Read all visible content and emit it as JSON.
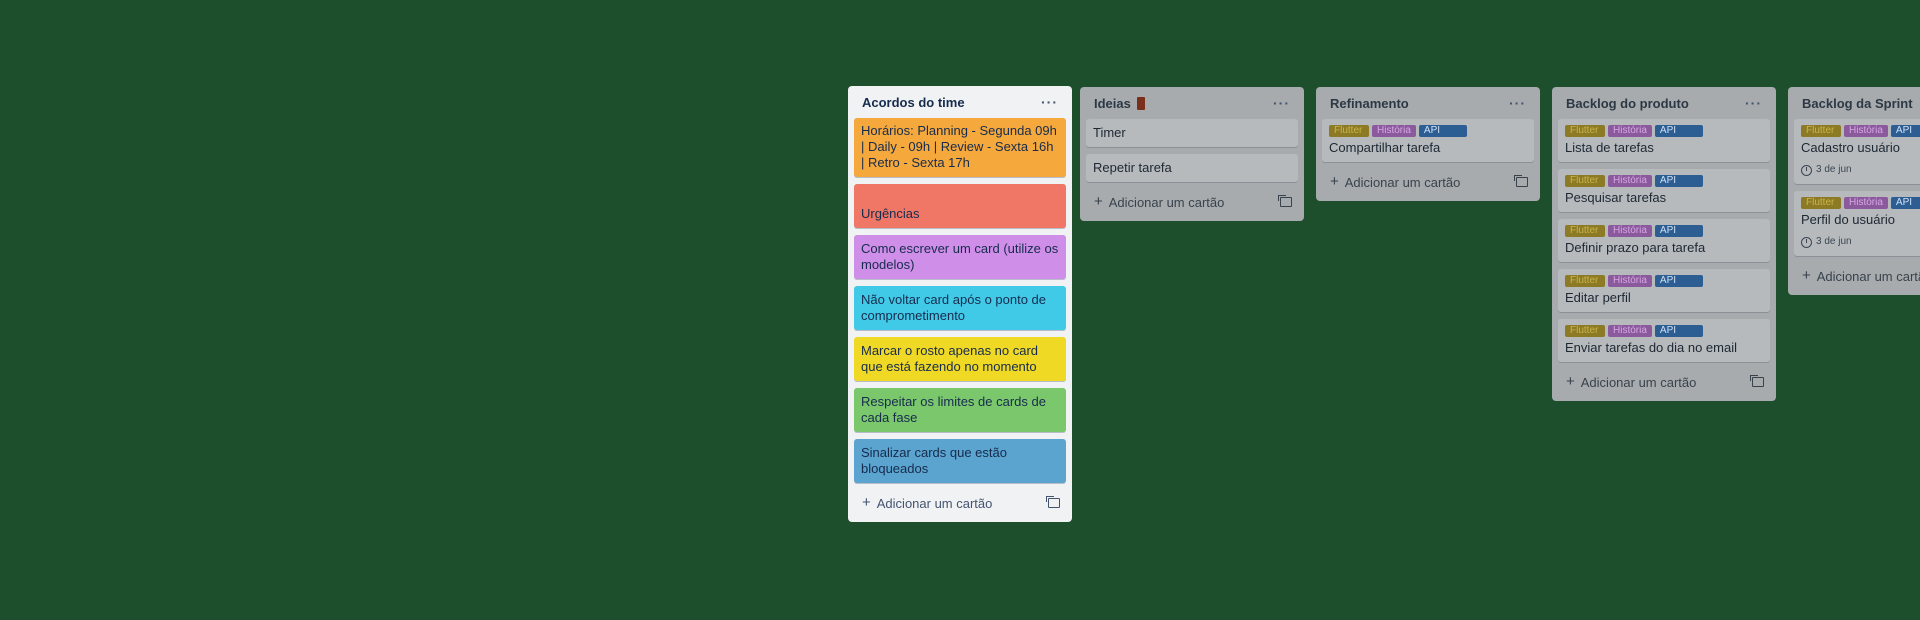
{
  "lists": [
    {
      "title": "Acordos do time",
      "cards": [
        {
          "text": "Horários: Planning - Segunda 09h | Daily - 09h | Review - Sexta 16h | Retro - Sexta 17h",
          "color": "#f5a93c"
        },
        {
          "text": "Urgências",
          "color": "#f07765"
        },
        {
          "text": "Como escrever um card (utilize os modelos)",
          "color": "#cf8ee8"
        },
        {
          "text": "Não voltar card após o ponto de comprometimento",
          "color": "#40cae8"
        },
        {
          "text": "Marcar o rosto apenas no card que está fazendo no momento",
          "color": "#f0d924"
        },
        {
          "text": "Respeitar os limites de cards de cada fase",
          "color": "#7bc86c"
        },
        {
          "text": "Sinalizar cards que estão bloqueados",
          "color": "#5ba4cf"
        }
      ],
      "add_label": "Adicionar um cartão"
    },
    {
      "title": "Ideias",
      "cards": [
        {
          "text": "Timer"
        },
        {
          "text": "Repetir tarefa"
        }
      ],
      "add_label": "Adicionar um cartão"
    },
    {
      "title": "Refinamento",
      "cards": [
        {
          "labels": [
            "Flutter",
            "História",
            "API"
          ],
          "text": "Compartilhar tarefa"
        }
      ],
      "add_label": "Adicionar um cartão"
    },
    {
      "title": "Backlog do produto",
      "cards": [
        {
          "labels": [
            "Flutter",
            "História",
            "API"
          ],
          "text": "Lista de tarefas"
        },
        {
          "labels": [
            "Flutter",
            "História",
            "API"
          ],
          "text": "Pesquisar tarefas"
        },
        {
          "labels": [
            "Flutter",
            "História",
            "API"
          ],
          "text": "Definir prazo para tarefa"
        },
        {
          "labels": [
            "Flutter",
            "História",
            "API"
          ],
          "text": "Editar perfil"
        },
        {
          "labels": [
            "Flutter",
            "História",
            "API"
          ],
          "text": "Enviar tarefas do dia no email"
        }
      ],
      "add_label": "Adicionar um cartão"
    },
    {
      "title": "Backlog da Sprint",
      "cards": [
        {
          "labels": [
            "Flutter",
            "História",
            "API"
          ],
          "text": "Cadastro usuário",
          "due": "3 de jun"
        },
        {
          "labels": [
            "Flutter",
            "História",
            "API"
          ],
          "text": "Perfil do usuário",
          "due": "3 de jun"
        }
      ],
      "add_label": "Adicionar um cartão"
    }
  ],
  "label_colors": {
    "Flutter": "#8d7a24",
    "História": "#8b5a9d",
    "API": "#2c5e93"
  },
  "label_text_colors": {
    "Flutter": "#c9b44a",
    "História": "#d6a7e2",
    "API": "#cfe0f3"
  },
  "icons": {
    "more": "ellipsis-icon",
    "add": "plus-icon",
    "template": "card-template-icon",
    "due": "clock-icon",
    "bookmark": "bookmark-icon"
  }
}
